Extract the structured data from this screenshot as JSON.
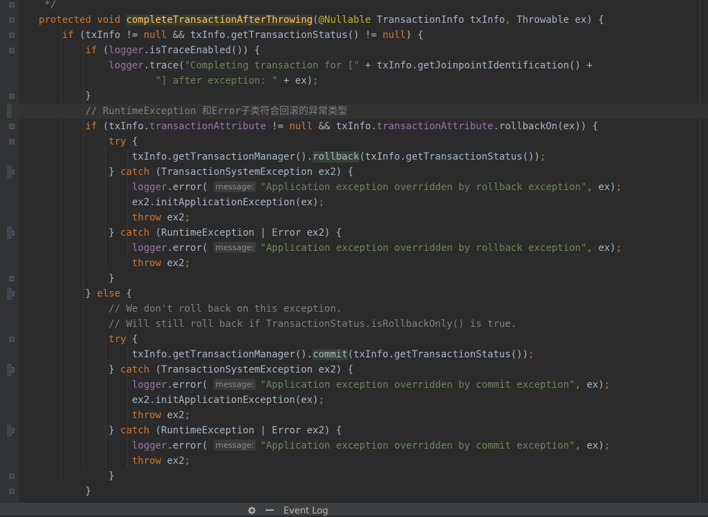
{
  "editor": {
    "lines": [
      {
        "segs": [
          [
            "cmt",
            " */"
          ]
        ]
      },
      {
        "segs": [
          [
            "kw",
            "protected "
          ],
          [
            "kw",
            "void "
          ],
          [
            "fnhl",
            "completeTransactionAfterThrowing"
          ],
          [
            "",
            "("
          ],
          [
            "ann",
            "@Nullable"
          ],
          [
            "",
            " TransactionInfo txInfo"
          ],
          [
            "kw",
            ", "
          ],
          [
            "",
            "Throwable ex) {"
          ]
        ]
      },
      {
        "segs": [
          [
            "kw",
            "    if "
          ],
          [
            "",
            "(txInfo != "
          ],
          [
            "kw",
            "null "
          ],
          [
            "",
            "&& txInfo.getTransactionStatus() != "
          ],
          [
            "kw",
            "null"
          ],
          [
            "",
            ") {"
          ]
        ]
      },
      {
        "segs": [
          [
            "kw",
            "        if "
          ],
          [
            "",
            "("
          ],
          [
            "fld",
            "logger"
          ],
          [
            "",
            ".isTraceEnabled()) {"
          ]
        ]
      },
      {
        "segs": [
          [
            "",
            "            "
          ],
          [
            "fld",
            "logger"
          ],
          [
            "",
            ".trace("
          ],
          [
            "str",
            "\"Completing transaction for [\" "
          ],
          [
            "",
            "+ txInfo.getJoinpointIdentification() +"
          ]
        ]
      },
      {
        "segs": [
          [
            "",
            "                    "
          ],
          [
            "str",
            "\"] after exception: \" "
          ],
          [
            "",
            "+ ex)"
          ],
          [
            "kw",
            ";"
          ]
        ]
      },
      {
        "segs": [
          [
            "",
            "        }"
          ]
        ]
      },
      {
        "segs": [
          [
            "",
            "        "
          ],
          [
            "cmt",
            "// RuntimeException 和Error子类符合回滚的异常类型"
          ]
        ],
        "current": true
      },
      {
        "segs": [
          [
            "kw",
            "        if "
          ],
          [
            "",
            "(txInfo."
          ],
          [
            "fld",
            "transactionAttribute"
          ],
          [
            "",
            " != "
          ],
          [
            "kw",
            "null "
          ],
          [
            "",
            "&& txInfo."
          ],
          [
            "fld",
            "transactionAttribute"
          ],
          [
            "",
            ".rollbackOn(ex)) {"
          ]
        ]
      },
      {
        "segs": [
          [
            "kw",
            "            try "
          ],
          [
            "",
            "{"
          ]
        ]
      },
      {
        "segs": [
          [
            "",
            "                txInfo.getTransactionManager()."
          ],
          [
            "methhl",
            "rollback"
          ],
          [
            "",
            "(txInfo.getTransactionStatus())"
          ],
          [
            "kw",
            ";"
          ]
        ]
      },
      {
        "segs": [
          [
            "",
            "            } "
          ],
          [
            "kw",
            "catch "
          ],
          [
            "",
            "(TransactionSystemException ex2) {"
          ]
        ]
      },
      {
        "segs": [
          [
            "",
            "                "
          ],
          [
            "fld",
            "logger"
          ],
          [
            "",
            ".error( "
          ],
          [
            "hint",
            "message:"
          ],
          [
            "str",
            "\"Application exception overridden by rollback exception\""
          ],
          [
            "kw",
            ", "
          ],
          [
            "",
            "ex)"
          ],
          [
            "kw",
            ";"
          ]
        ]
      },
      {
        "segs": [
          [
            "",
            "                ex2.initApplicationException(ex)"
          ],
          [
            "kw",
            ";"
          ]
        ]
      },
      {
        "segs": [
          [
            "kw",
            "                throw "
          ],
          [
            "",
            "ex2"
          ],
          [
            "kw",
            ";"
          ]
        ]
      },
      {
        "segs": [
          [
            "",
            "            } "
          ],
          [
            "kw",
            "catch "
          ],
          [
            "",
            "(RuntimeException | Error ex2) {"
          ]
        ]
      },
      {
        "segs": [
          [
            "",
            "                "
          ],
          [
            "fld",
            "logger"
          ],
          [
            "",
            ".error( "
          ],
          [
            "hint",
            "message:"
          ],
          [
            "str",
            "\"Application exception overridden by rollback exception\""
          ],
          [
            "kw",
            ", "
          ],
          [
            "",
            "ex)"
          ],
          [
            "kw",
            ";"
          ]
        ]
      },
      {
        "segs": [
          [
            "kw",
            "                throw "
          ],
          [
            "",
            "ex2"
          ],
          [
            "kw",
            ";"
          ]
        ]
      },
      {
        "segs": [
          [
            "",
            "            }"
          ]
        ]
      },
      {
        "segs": [
          [
            "",
            "        } "
          ],
          [
            "kw",
            "else "
          ],
          [
            "",
            "{"
          ]
        ]
      },
      {
        "segs": [
          [
            "",
            "            "
          ],
          [
            "cmt",
            "// We don't roll back on this exception."
          ]
        ]
      },
      {
        "segs": [
          [
            "",
            "            "
          ],
          [
            "cmt",
            "// Will still roll back if TransactionStatus.isRollbackOnly() is true."
          ]
        ]
      },
      {
        "segs": [
          [
            "kw",
            "            try "
          ],
          [
            "",
            "{"
          ]
        ]
      },
      {
        "segs": [
          [
            "",
            "                txInfo.getTransactionManager()."
          ],
          [
            "methhl",
            "commit"
          ],
          [
            "",
            "(txInfo.getTransactionStatus())"
          ],
          [
            "kw",
            ";"
          ]
        ]
      },
      {
        "segs": [
          [
            "",
            "            } "
          ],
          [
            "kw",
            "catch "
          ],
          [
            "",
            "(TransactionSystemException ex2) {"
          ]
        ]
      },
      {
        "segs": [
          [
            "",
            "                "
          ],
          [
            "fld",
            "logger"
          ],
          [
            "",
            ".error( "
          ],
          [
            "hint",
            "message:"
          ],
          [
            "str",
            "\"Application exception overridden by commit exception\""
          ],
          [
            "kw",
            ", "
          ],
          [
            "",
            "ex)"
          ],
          [
            "kw",
            ";"
          ]
        ]
      },
      {
        "segs": [
          [
            "",
            "                ex2.initApplicationException(ex)"
          ],
          [
            "kw",
            ";"
          ]
        ]
      },
      {
        "segs": [
          [
            "kw",
            "                throw "
          ],
          [
            "",
            "ex2"
          ],
          [
            "kw",
            ";"
          ]
        ]
      },
      {
        "segs": [
          [
            "",
            "            } "
          ],
          [
            "kw",
            "catch "
          ],
          [
            "",
            "(RuntimeException | Error ex2) {"
          ]
        ]
      },
      {
        "segs": [
          [
            "",
            "                "
          ],
          [
            "fld",
            "logger"
          ],
          [
            "",
            ".error( "
          ],
          [
            "hint",
            "message:"
          ],
          [
            "str",
            "\"Application exception overridden by commit exception\""
          ],
          [
            "kw",
            ", "
          ],
          [
            "",
            "ex)"
          ],
          [
            "kw",
            ";"
          ]
        ]
      },
      {
        "segs": [
          [
            "kw",
            "                throw "
          ],
          [
            "",
            "ex2"
          ],
          [
            "kw",
            ";"
          ]
        ]
      },
      {
        "segs": [
          [
            "",
            "            }"
          ]
        ]
      },
      {
        "segs": [
          [
            "",
            "        }"
          ]
        ]
      }
    ]
  },
  "statusbar": {
    "settings_icon": "gear-icon",
    "hide_icon": "minus-icon",
    "event_log_label": "Event Log"
  }
}
